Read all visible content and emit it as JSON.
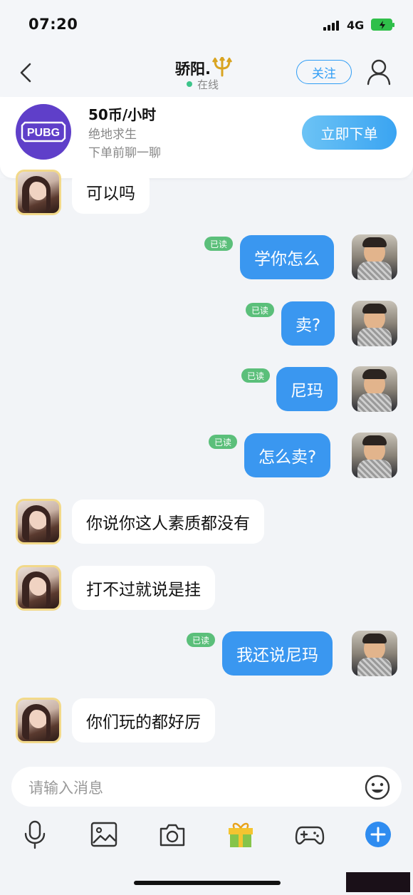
{
  "status_bar": {
    "time": "07:20",
    "network": "4G"
  },
  "header": {
    "peer_name": "骄阳.",
    "status": "在线",
    "follow_label": "关注"
  },
  "order": {
    "logo_text": "PUBG",
    "price": "50币/小时",
    "game": "绝地求生",
    "hint": "下单前聊一聊",
    "button_label": "立即下单"
  },
  "messages": [
    {
      "from": "them",
      "text": "可以吗"
    },
    {
      "from": "me",
      "text": "学你怎么",
      "read": "已读"
    },
    {
      "from": "me",
      "text": "卖?",
      "read": "已读"
    },
    {
      "from": "me",
      "text": "尼玛",
      "read": "已读"
    },
    {
      "from": "me",
      "text": "怎么卖?",
      "read": "已读"
    },
    {
      "from": "them",
      "text": "你说你这人素质都没有"
    },
    {
      "from": "them",
      "text": "打不过就说是挂"
    },
    {
      "from": "me",
      "text": "我还说尼玛",
      "read": "已读"
    },
    {
      "from": "them",
      "text": "你们玩的都好厉"
    }
  ],
  "input": {
    "placeholder": "请输入消息"
  },
  "toolbar": [
    "microphone-icon",
    "image-icon",
    "camera-icon",
    "gift-icon",
    "gamepad-icon",
    "plus-icon"
  ],
  "colors": {
    "accent": "#3a97f0",
    "read_tag": "#5bbf7a",
    "online": "#3cc48a",
    "logo_bg": "#5f3fc9"
  }
}
